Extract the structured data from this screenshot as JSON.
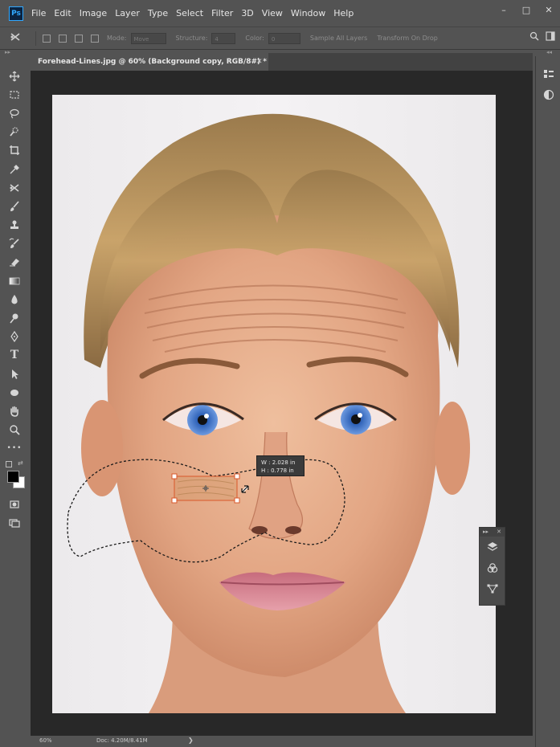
{
  "app": {
    "logo": "Ps"
  },
  "menu": [
    "File",
    "Edit",
    "Image",
    "Layer",
    "Type",
    "Select",
    "Filter",
    "3D",
    "View",
    "Window",
    "Help"
  ],
  "window_controls": {
    "minimize": "–",
    "restore": "□",
    "close": "✕"
  },
  "options_bar": {
    "mode_label": "Mode:",
    "mode_value": "Move",
    "structure_label": "Structure:",
    "structure_value": "4",
    "color_label": "Color:",
    "color_value": "0",
    "sample_all_layers": "Sample All Layers",
    "transform_on_drop": "Transform On Drop"
  },
  "document_tab": {
    "title": "Forehead-Lines.jpg @ 60% (Background copy, RGB/8#) *",
    "close": "✕"
  },
  "tools": [
    "move-tool",
    "marquee-tool",
    "lasso-tool",
    "quick-select-tool",
    "crop-tool",
    "eyedropper-tool",
    "patch-tool",
    "brush-tool",
    "clone-stamp-tool",
    "history-brush-tool",
    "eraser-tool",
    "gradient-tool",
    "blur-tool",
    "dodge-tool",
    "pen-tool",
    "type-tool",
    "path-select-tool",
    "shape-tool",
    "hand-tool",
    "zoom-tool"
  ],
  "tool_glyphs": {
    "type-tool": "T",
    "more": "•••"
  },
  "transform_tooltip": {
    "width": "W :  2.028 in",
    "height": "H :  0.778 in"
  },
  "status": {
    "zoom": "60%",
    "doc": "Doc: 4.20M/8.41M",
    "arrow": "❯"
  },
  "panel_strip": {
    "left": "▸▸",
    "right": "◂◂"
  },
  "float_panel": {
    "collapse": "▸▸",
    "close": "✕"
  },
  "colors": {
    "ui_bg": "#535353",
    "workspace": "#282828",
    "accent": "#31a8ff",
    "foreground_swatch": "#000000",
    "background_swatch": "#ffffff",
    "transform_handle": "#d9572a"
  }
}
